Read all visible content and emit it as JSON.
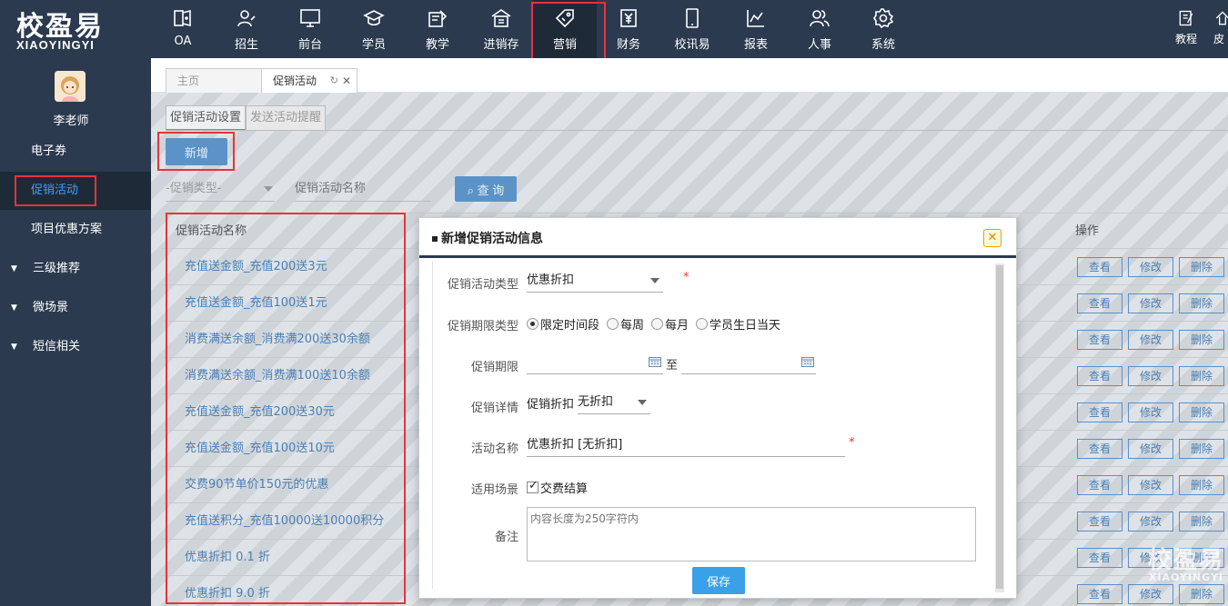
{
  "logo": {
    "cn": "校盈易",
    "en": "XIAOYINGYI"
  },
  "nav": [
    {
      "label": "OA",
      "icon": "oa-icon"
    },
    {
      "label": "招生",
      "icon": "enroll-icon"
    },
    {
      "label": "前台",
      "icon": "monitor-icon"
    },
    {
      "label": "学员",
      "icon": "graduation-cap-icon"
    },
    {
      "label": "教学",
      "icon": "teaching-icon"
    },
    {
      "label": "进销存",
      "icon": "warehouse-icon"
    },
    {
      "label": "营销",
      "icon": "tag-icon",
      "active": true
    },
    {
      "label": "财务",
      "icon": "finance-icon"
    },
    {
      "label": "校讯易",
      "icon": "phone-icon"
    },
    {
      "label": "报表",
      "icon": "chart-icon"
    },
    {
      "label": "人事",
      "icon": "people-icon"
    },
    {
      "label": "系统",
      "icon": "gear-icon"
    }
  ],
  "top_right": [
    {
      "label": "教程",
      "icon": "tutorial-icon"
    },
    {
      "label": "皮",
      "icon": "skin-icon"
    }
  ],
  "user": {
    "name": "李老师"
  },
  "sidebar": {
    "items": [
      {
        "label": "电子券"
      },
      {
        "label": "促销活动",
        "active": true
      },
      {
        "label": "项目优惠方案"
      },
      {
        "label": "三级推荐",
        "caret": "▼"
      },
      {
        "label": "微场景",
        "caret": "▼"
      },
      {
        "label": "短信相关",
        "caret": "▼"
      }
    ]
  },
  "tabs": [
    {
      "label": "主页"
    },
    {
      "label": "促销活动",
      "refresh": "↻",
      "close": "✕"
    }
  ],
  "subtabs": [
    "促销活动设置",
    "发送活动提醒"
  ],
  "toolbar": {
    "add_label": "新增",
    "type_select": "-促销类型-",
    "name_placeholder": "促销活动名称",
    "query_label": "查 询"
  },
  "table": {
    "headers": {
      "name": "促销活动名称",
      "ops": "操作"
    },
    "rows": [
      "充值送金额_充值200送3元",
      "充值送金额_充值100送1元",
      "消费满送余额_消费满200送30余额",
      "消费满送余额_消费满100送10余额",
      "充值送金额_充值200送30元",
      "充值送金额_充值100送10元",
      "交费90节单价150元的优惠",
      "充值送积分_充值10000送10000积分",
      "优惠折扣 0.1 折",
      "优惠折扣 9.0 折"
    ],
    "op_view": "查看",
    "op_edit": "修改",
    "op_delete": "删除"
  },
  "modal": {
    "title": "新增促销活动信息",
    "close": "✕",
    "fields": {
      "type_label": "促销活动类型",
      "type_value": "优惠折扣",
      "required_mark": "*",
      "period_type_label": "促销期限类型",
      "period_options": [
        "限定时间段",
        "每周",
        "每月",
        "学员生日当天"
      ],
      "period_label": "促销期限",
      "to_label": "至",
      "detail_label": "促销详情",
      "detail_prefix": "促销折扣",
      "detail_value": "无折扣",
      "name_label": "活动名称",
      "name_value": "优惠折扣 [无折扣]",
      "scene_label": "适用场景",
      "scene_check": "交费结算",
      "remark_label": "备注",
      "remark_placeholder": "内容长度为250字符内"
    },
    "save_label": "保存"
  },
  "colors": {
    "nav_bg": "#2b3a4e",
    "highlight": "#e8333a",
    "accent": "#3aa0e8",
    "link": "#4a7fb5"
  }
}
